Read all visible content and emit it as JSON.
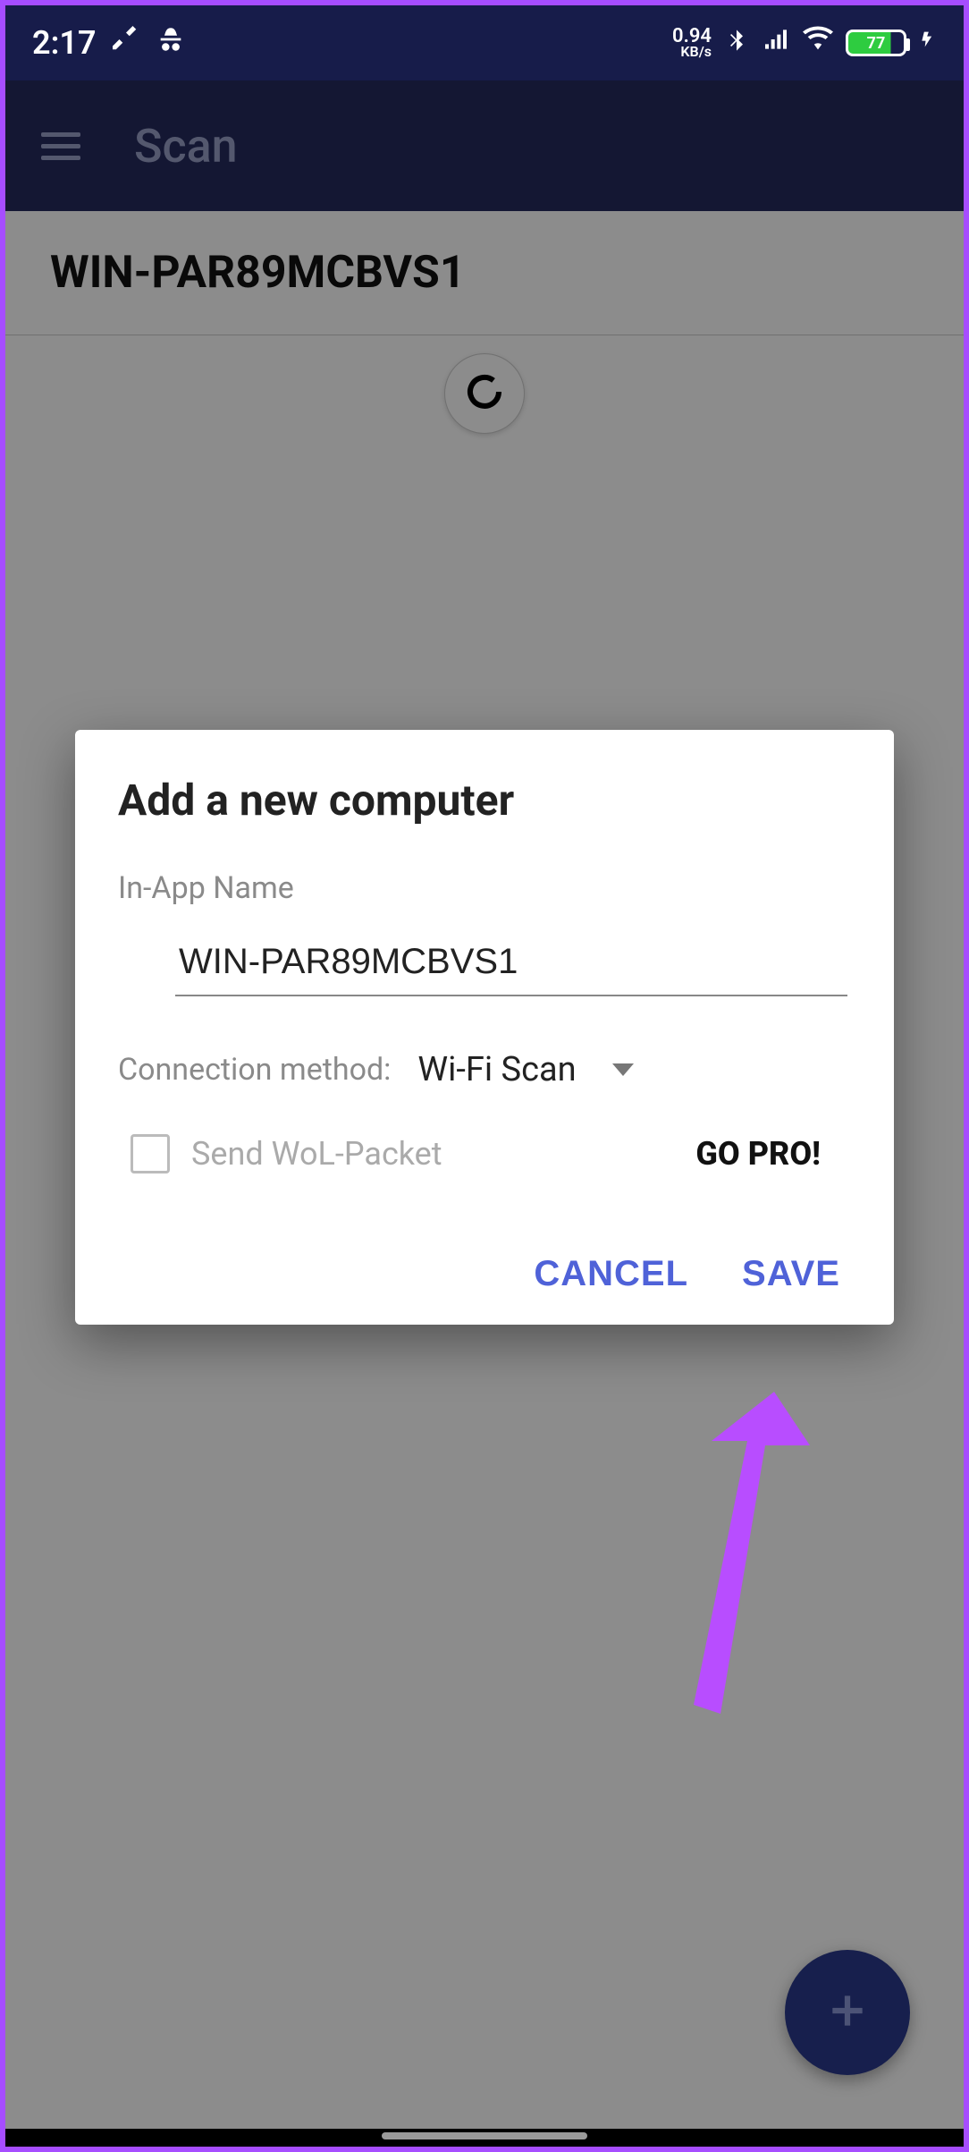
{
  "statusbar": {
    "time": "2:17",
    "speed_value": "0.94",
    "speed_unit": "KB/s",
    "battery_pct": "77"
  },
  "appbar": {
    "title": "Scan"
  },
  "main": {
    "device_name": "WIN-PAR89MCBVS1"
  },
  "dialog": {
    "title": "Add a new computer",
    "name_label": "In-App Name",
    "name_value": "WIN-PAR89MCBVS1",
    "conn_label": "Connection method:",
    "conn_value": "Wi-Fi Scan",
    "wol_label": "Send WoL-Packet",
    "gopro_label": "GO PRO!",
    "cancel_label": "CANCEL",
    "save_label": "SAVE"
  },
  "icons": {
    "menu": "menu-icon",
    "incognito": "incognito-icon",
    "tools": "tools-icon",
    "bluetooth": "bluetooth-icon",
    "signal": "signal-icon",
    "wifi": "wifi-icon",
    "battery": "battery-icon",
    "bolt": "bolt-icon",
    "refresh": "refresh-icon",
    "plus": "plus-icon",
    "dropdown": "chevron-down-icon"
  }
}
